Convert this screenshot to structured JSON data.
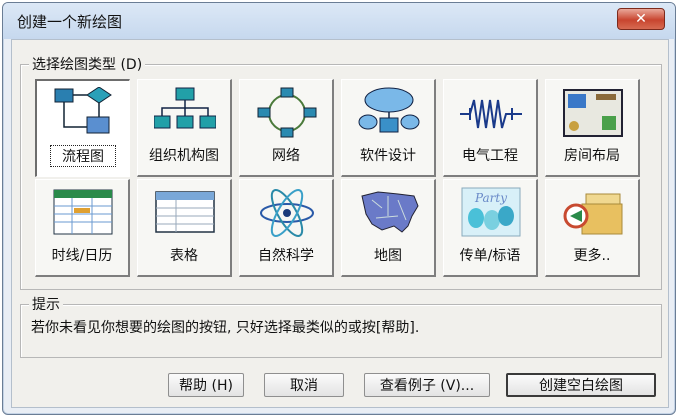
{
  "window": {
    "title": "创建一个新绘图",
    "close_icon": "close-icon",
    "colors": {
      "titlebar": "#c6d8ee",
      "close": "#c8452f",
      "face": "#f1f0ec"
    }
  },
  "types_group": {
    "label": "选择绘图类型 (D)",
    "tiles": [
      {
        "label": "流程图",
        "icon": "flowchart-icon",
        "selected": true
      },
      {
        "label": "组织机构图",
        "icon": "org-chart-icon"
      },
      {
        "label": "网络",
        "icon": "network-icon"
      },
      {
        "label": "软件设计",
        "icon": "software-design-icon"
      },
      {
        "label": "电气工程",
        "icon": "electrical-icon"
      },
      {
        "label": "房间布局",
        "icon": "room-layout-icon"
      },
      {
        "label": "时线/日历",
        "icon": "calendar-icon"
      },
      {
        "label": "表格",
        "icon": "table-icon"
      },
      {
        "label": "自然科学",
        "icon": "atom-icon"
      },
      {
        "label": "地图",
        "icon": "map-icon"
      },
      {
        "label": "传单/标语",
        "icon": "party-banner-icon"
      },
      {
        "label": "更多..",
        "icon": "more-folder-icon"
      }
    ]
  },
  "hint": {
    "label": "提示",
    "text": "若你未看见你想要的绘图的按钮, 只好选择最类似的或按[帮助]."
  },
  "buttons": {
    "help": "帮助 (H)",
    "cancel": "取消",
    "examples": "查看例子 (V)...",
    "create_blank": "创建空白绘图"
  }
}
